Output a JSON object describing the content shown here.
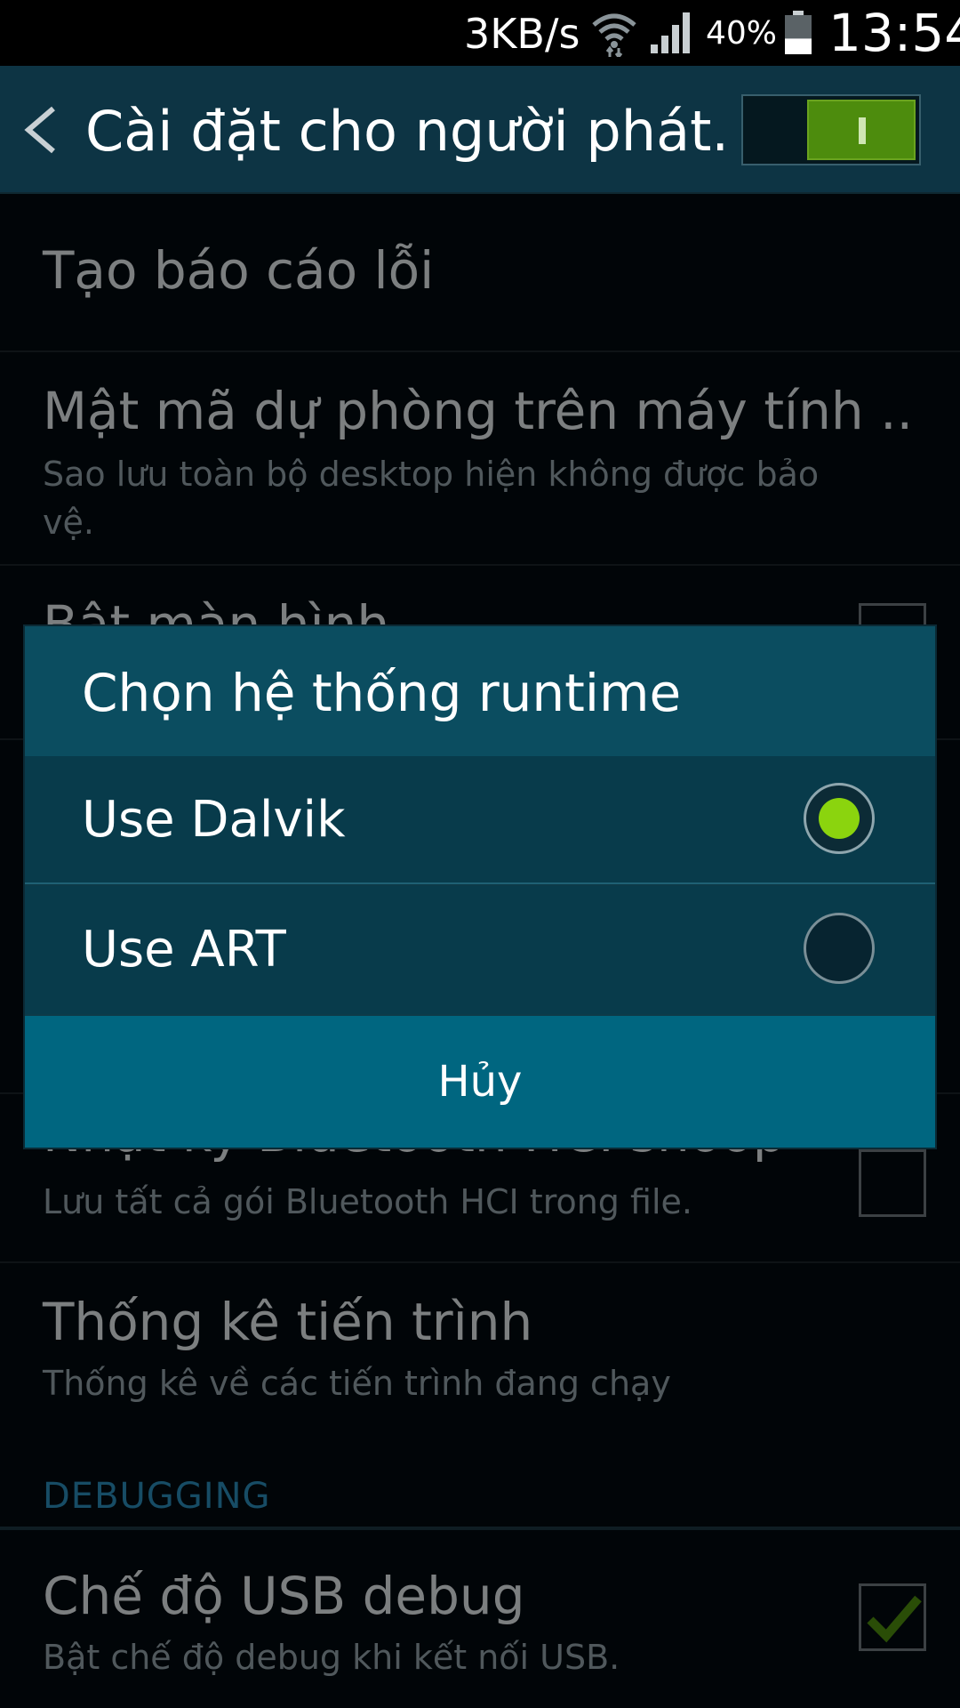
{
  "status_bar": {
    "speed": "3KB/s",
    "battery_percent": "40%",
    "time": "13:54",
    "battery_level": 0.4,
    "icons": [
      "wifi-icon",
      "signal-icon",
      "battery-icon"
    ]
  },
  "app_bar": {
    "title": "Cài đặt cho người phát..",
    "master_toggle_on": true
  },
  "settings": {
    "bug_report": {
      "title": "Tạo báo cáo lỗi"
    },
    "backup_password": {
      "title": "Mật mã dự phòng trên máy tính ..",
      "summary": "Sao lưu toàn bộ desktop hiện không được bảo vệ."
    },
    "stay_awake": {
      "title": "Bật màn hình"
    },
    "bt_hci": {
      "title": "Nhật ký Bluetooth HCI snoop",
      "summary": "Lưu tất cả gói Bluetooth HCI trong file."
    },
    "process_stats": {
      "title": "Thống kê tiến trình",
      "summary": "Thống kê về các tiến trình đang chạy"
    },
    "section_debugging": "DEBUGGING",
    "usb_debug": {
      "title": "Chế độ USB debug",
      "summary": "Bật chế độ debug khi kết nối USB.",
      "checked": true
    }
  },
  "dialog": {
    "title": "Chọn hệ thống runtime",
    "options": [
      {
        "label": "Use Dalvik",
        "selected": true
      },
      {
        "label": "Use ART",
        "selected": false
      }
    ],
    "cancel_label": "Hủy"
  },
  "colors": {
    "accent_green": "#8bd40e",
    "dialog_title_bg": "#0b4d60",
    "dialog_button_bg": "#006680",
    "app_bar_bg": "#0d3444"
  }
}
